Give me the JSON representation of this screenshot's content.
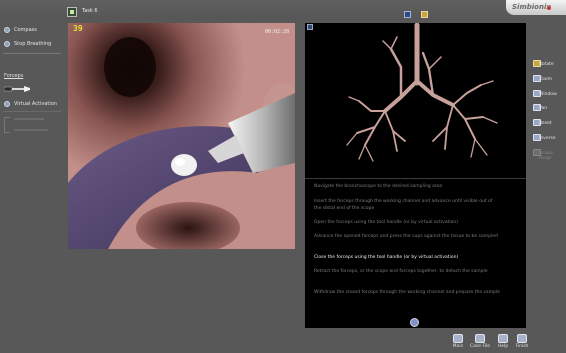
{
  "header": {
    "task_label": "Task 6",
    "logo_text": "Simbionix"
  },
  "sidebar": {
    "compass_label": "Compass",
    "stop_breathing_label": "Stop Breathing",
    "forceps_heading": "Forceps",
    "virtual_activation_label": "Virtual Activation"
  },
  "endoscope_view": {
    "counter": "39",
    "timer": "00:02:20"
  },
  "instructions": {
    "steps": [
      {
        "text": "Navigate the bronchoscope to the desired sampling area",
        "active": false
      },
      {
        "text": "Insert the forceps through the working channel and advance until visible out of the distal end of the scope",
        "active": false
      },
      {
        "text": "Open the forceps using the tool handle (or by virtual activation)",
        "active": false
      },
      {
        "text": "Advance the opened forceps and press the cups against the tissue to be sampled",
        "active": false
      },
      {
        "text": "Close the forceps using the tool handle (or by virtual activation)",
        "active": true
      },
      {
        "text": "Retract the forceps, or the scope and forceps together, to detach the sample",
        "active": false
      },
      {
        "text": "Withdraw the closed forceps through the working channel and prepare the sample",
        "active": false
      }
    ]
  },
  "right_toolbar": {
    "rotate": "Rotate",
    "zoom": "Zoom",
    "window": "Window",
    "pan": "Pan",
    "reset": "Reset",
    "inverse": "Inverse",
    "scope_rings": "Scope Rings"
  },
  "bottom_toolbar": {
    "main": "Main",
    "case_file": "Case File",
    "help": "Help",
    "finish": "Finish"
  },
  "colors": {
    "background": "#585858",
    "counter": "#e7e03a",
    "tissue": "#b07a75",
    "panel": "#000000",
    "active_step": "#f0f0f0",
    "inactive_step": "#7c7c7c"
  }
}
